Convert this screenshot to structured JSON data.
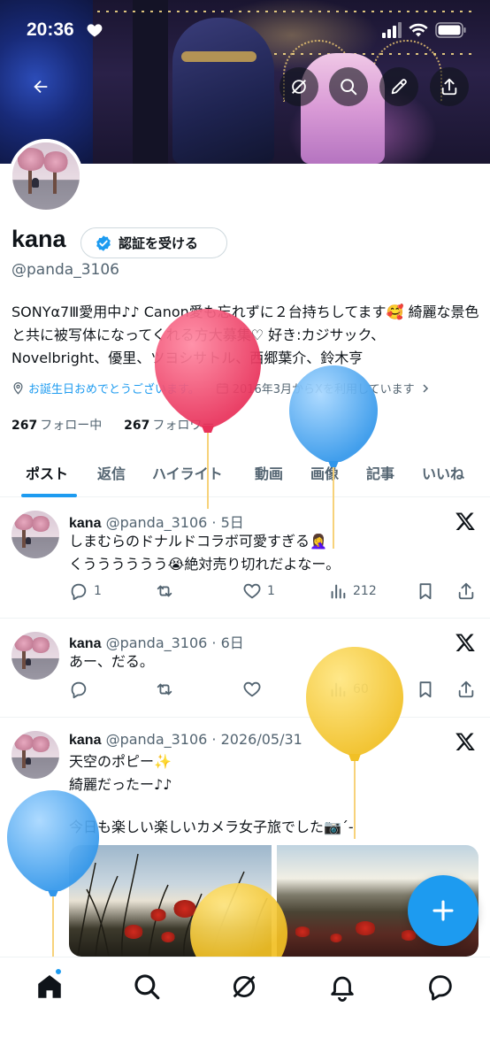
{
  "status_bar": {
    "time": "20:36"
  },
  "profile": {
    "name": "kana",
    "verify_label": "認証を受ける",
    "handle": "@panda_3106",
    "bio": "SONYα7Ⅲ愛用中♪♪ Canon愛も忘れずに２台持ちしてます🥰 綺麗な景色と共に被写体になってくれる方大募集♡ 好き:カジサック、Novelbright、優里、ツヨシサトル、西郷葉介、鈴木亨",
    "birthday_text": "お誕生日おめでとうございます。",
    "joined_text": "2016年3月からXを利用しています",
    "following_count": "267",
    "following_label": "フォロー中",
    "followers_count": "267",
    "followers_label": "フォロワー"
  },
  "tabs": [
    "ポスト",
    "返信",
    "ハイライト",
    "動画",
    "画像",
    "記事",
    "いいね"
  ],
  "active_tab": "ポスト",
  "posts": [
    {
      "name": "kana",
      "meta": "@panda_3106 · 5日",
      "line1": "しまむらのドナルドコラボ可愛すぎる🤦‍♀️",
      "line2": "くうううううう😭絶対売り切れだよなー。",
      "replies": "1",
      "likes": "1",
      "views": "212"
    },
    {
      "name": "kana",
      "meta": "@panda_3106 · 6日",
      "line1": "あー、だる。",
      "views": "60"
    },
    {
      "name": "kana",
      "meta": "@panda_3106 · 2026/05/31",
      "line1": "天空のポピー✨",
      "line2": "綺麗だったー♪♪",
      "line3": "今日も楽しい楽しいカメラ女子旅でした📷´-"
    }
  ],
  "colors": {
    "accent": "#1d9bf0",
    "text_primary": "#0f1419",
    "text_secondary": "#536471",
    "balloon_red": "#f04a6e",
    "balloon_blue": "#4aaaf5",
    "balloon_yellow": "#f7cf3c"
  },
  "icons": [
    "back-arrow-icon",
    "grok-icon",
    "search-icon",
    "edit-icon",
    "share-icon",
    "verified-badge-icon",
    "location-icon",
    "calendar-icon",
    "x-logo-icon",
    "reply-icon",
    "repost-icon",
    "like-icon",
    "views-icon",
    "bookmark-icon",
    "compose-plus-icon",
    "home-icon",
    "notifications-icon",
    "messages-icon"
  ]
}
